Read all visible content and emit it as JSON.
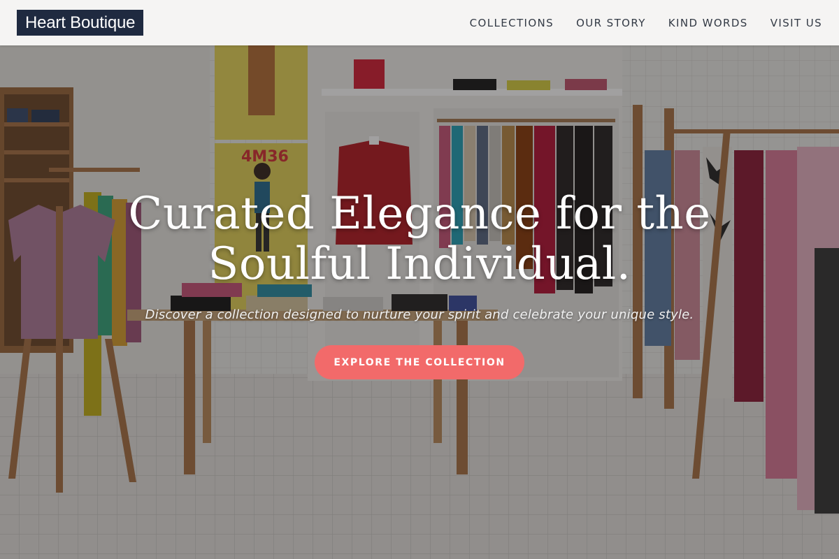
{
  "brand": {
    "name": "Heart Boutique"
  },
  "nav": {
    "items": [
      {
        "label": "COLLECTIONS"
      },
      {
        "label": "OUR STORY"
      },
      {
        "label": "KIND WORDS"
      },
      {
        "label": "VISIT US"
      }
    ]
  },
  "hero": {
    "headline_line1": "Curated Elegance for the",
    "headline_line2": "Soulful Individual.",
    "subheadline": "Discover a collection designed to nurture your spirit and celebrate your unique style.",
    "cta_label": "EXPLORE THE COLLECTION",
    "poster_text": "4M36"
  },
  "colors": {
    "header_bg": "#f5f4f2",
    "logo_bg": "#1f2a40",
    "accent": "#f26a6a"
  }
}
